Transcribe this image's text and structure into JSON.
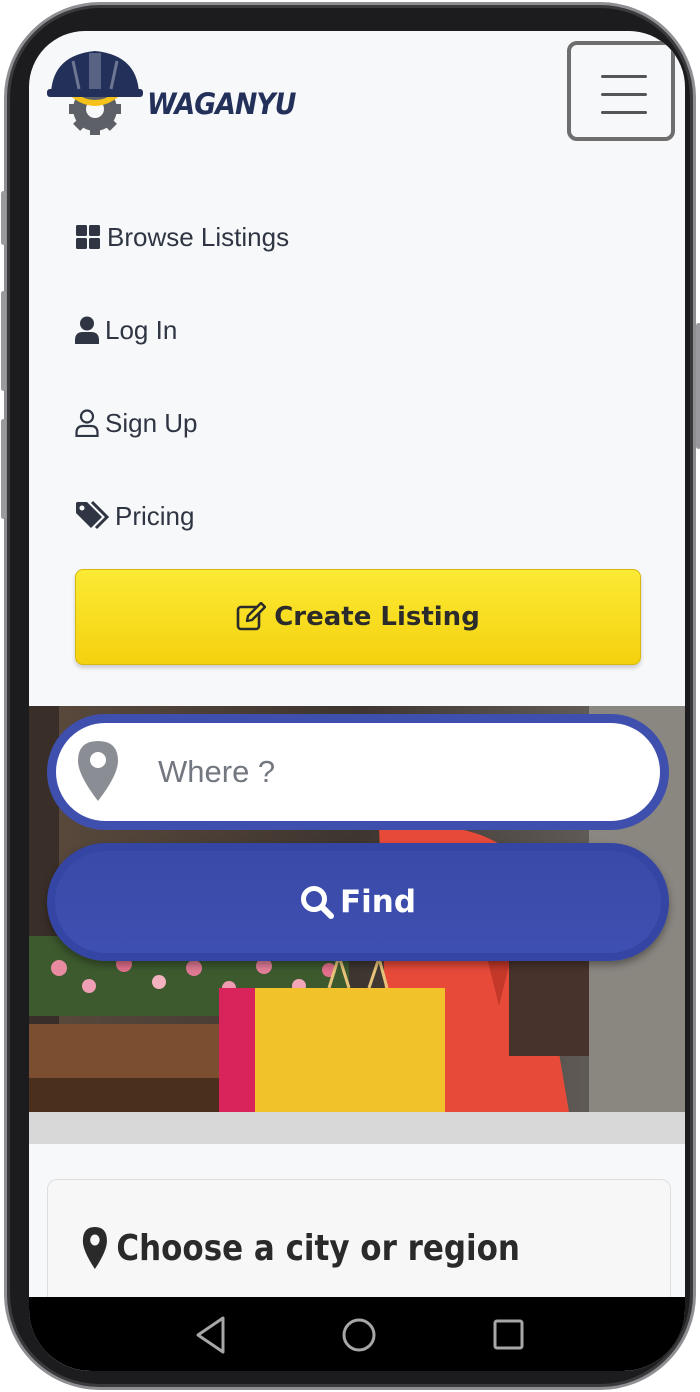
{
  "brand": {
    "name": "WAGANYU"
  },
  "header": {
    "menu_toggle": "hamburger-icon"
  },
  "nav": {
    "items": [
      {
        "label": "Browse Listings",
        "icon": "grid-icon"
      },
      {
        "label": "Log In",
        "icon": "user-icon"
      },
      {
        "label": "Sign Up",
        "icon": "user-outline-icon"
      },
      {
        "label": "Pricing",
        "icon": "tags-icon"
      }
    ],
    "create_listing": {
      "label": "Create Listing",
      "icon": "edit-icon"
    }
  },
  "search": {
    "placeholder": "Where ?",
    "value": "",
    "find_label": "Find",
    "pin_icon": "map-marker-icon",
    "find_icon": "search-icon"
  },
  "city_section": {
    "title": "Choose a city or region",
    "icon": "map-marker-icon"
  },
  "system_nav": {
    "back": "back-icon",
    "home": "home-icon",
    "recents": "recents-icon"
  },
  "colors": {
    "accent_yellow": "#F6D71B",
    "primary_blue": "#3E4FB2",
    "text_dark": "#2F3542",
    "brand_navy": "#23305A"
  }
}
